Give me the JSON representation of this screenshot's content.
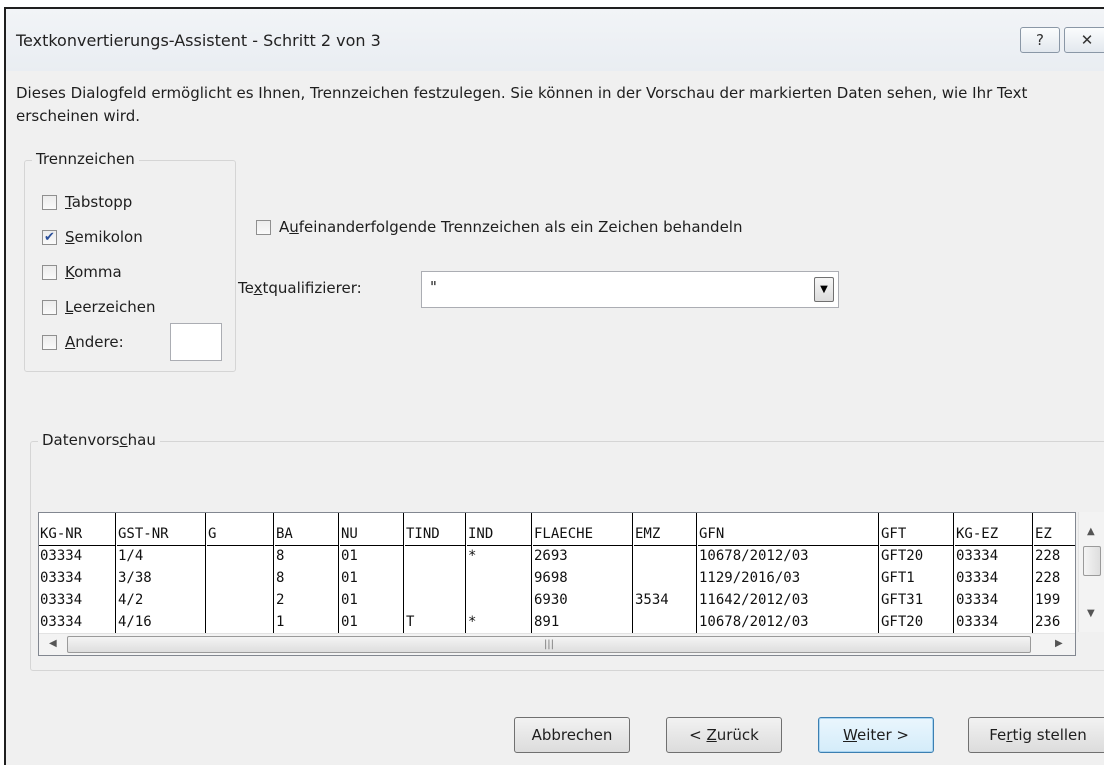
{
  "window": {
    "title": "Textkonvertierungs-Assistent - Schritt 2 von 3"
  },
  "titlebar": {
    "help_glyph": "?",
    "close_glyph": "✕"
  },
  "description": "Dieses Dialogfeld ermöglicht es Ihnen, Trennzeichen festzulegen. Sie können in der Vorschau der markierten Daten sehen, wie Ihr Text erscheinen wird.",
  "delimiters": {
    "legend": "Trennzeichen",
    "options": [
      {
        "first": "T",
        "rest": "abstopp",
        "checked": false
      },
      {
        "first": "S",
        "rest": "emikolon",
        "checked": true
      },
      {
        "first": "K",
        "rest": "omma",
        "checked": false
      },
      {
        "first": "L",
        "rest": "eerzeichen",
        "checked": false
      },
      {
        "first": "A",
        "rest": "ndere:",
        "checked": false
      }
    ],
    "other_value": ""
  },
  "consecutive": {
    "pre": "A",
    "accel": "u",
    "post": "feinanderfolgende Trennzeichen als ein Zeichen behandeln",
    "checked": false
  },
  "qualifier": {
    "pre": "Te",
    "accel": "x",
    "post": "tqualifizierer:",
    "value": "\""
  },
  "preview": {
    "legend_pre": "Datenvors",
    "legend_accel": "c",
    "legend_post": "hau",
    "columns": [
      "KG-NR",
      "GST-NR",
      "G",
      "BA",
      "NU",
      "TIND",
      "IND",
      "FLAECHE",
      "EMZ",
      "GFN",
      "GFT",
      "KG-EZ",
      "EZ"
    ],
    "rows": [
      [
        "03334",
        "1/4",
        "",
        "8",
        "01",
        "",
        "*",
        "2693",
        "",
        "10678/2012/03",
        "GFT20",
        "03334",
        "228"
      ],
      [
        "03334",
        "3/38",
        "",
        "8",
        "01",
        "",
        "",
        "9698",
        "",
        "1129/2016/03",
        "GFT1",
        "03334",
        "228"
      ],
      [
        "03334",
        "4/2",
        "",
        "2",
        "01",
        "",
        "",
        "6930",
        "3534",
        "11642/2012/03",
        "GFT31",
        "03334",
        "199"
      ],
      [
        "03334",
        "4/16",
        "",
        "1",
        "01",
        "T",
        "*",
        "891",
        "",
        "10678/2012/03",
        "GFT20",
        "03334",
        "236"
      ]
    ]
  },
  "buttons": {
    "cancel": "Abbrechen",
    "back_pre": "< ",
    "back_accel": "Z",
    "back_post": "urück",
    "next_accel": "W",
    "next_post": "eiter >",
    "finish_pre": "Fe",
    "finish_accel": "r",
    "finish_post": "tig stellen"
  }
}
